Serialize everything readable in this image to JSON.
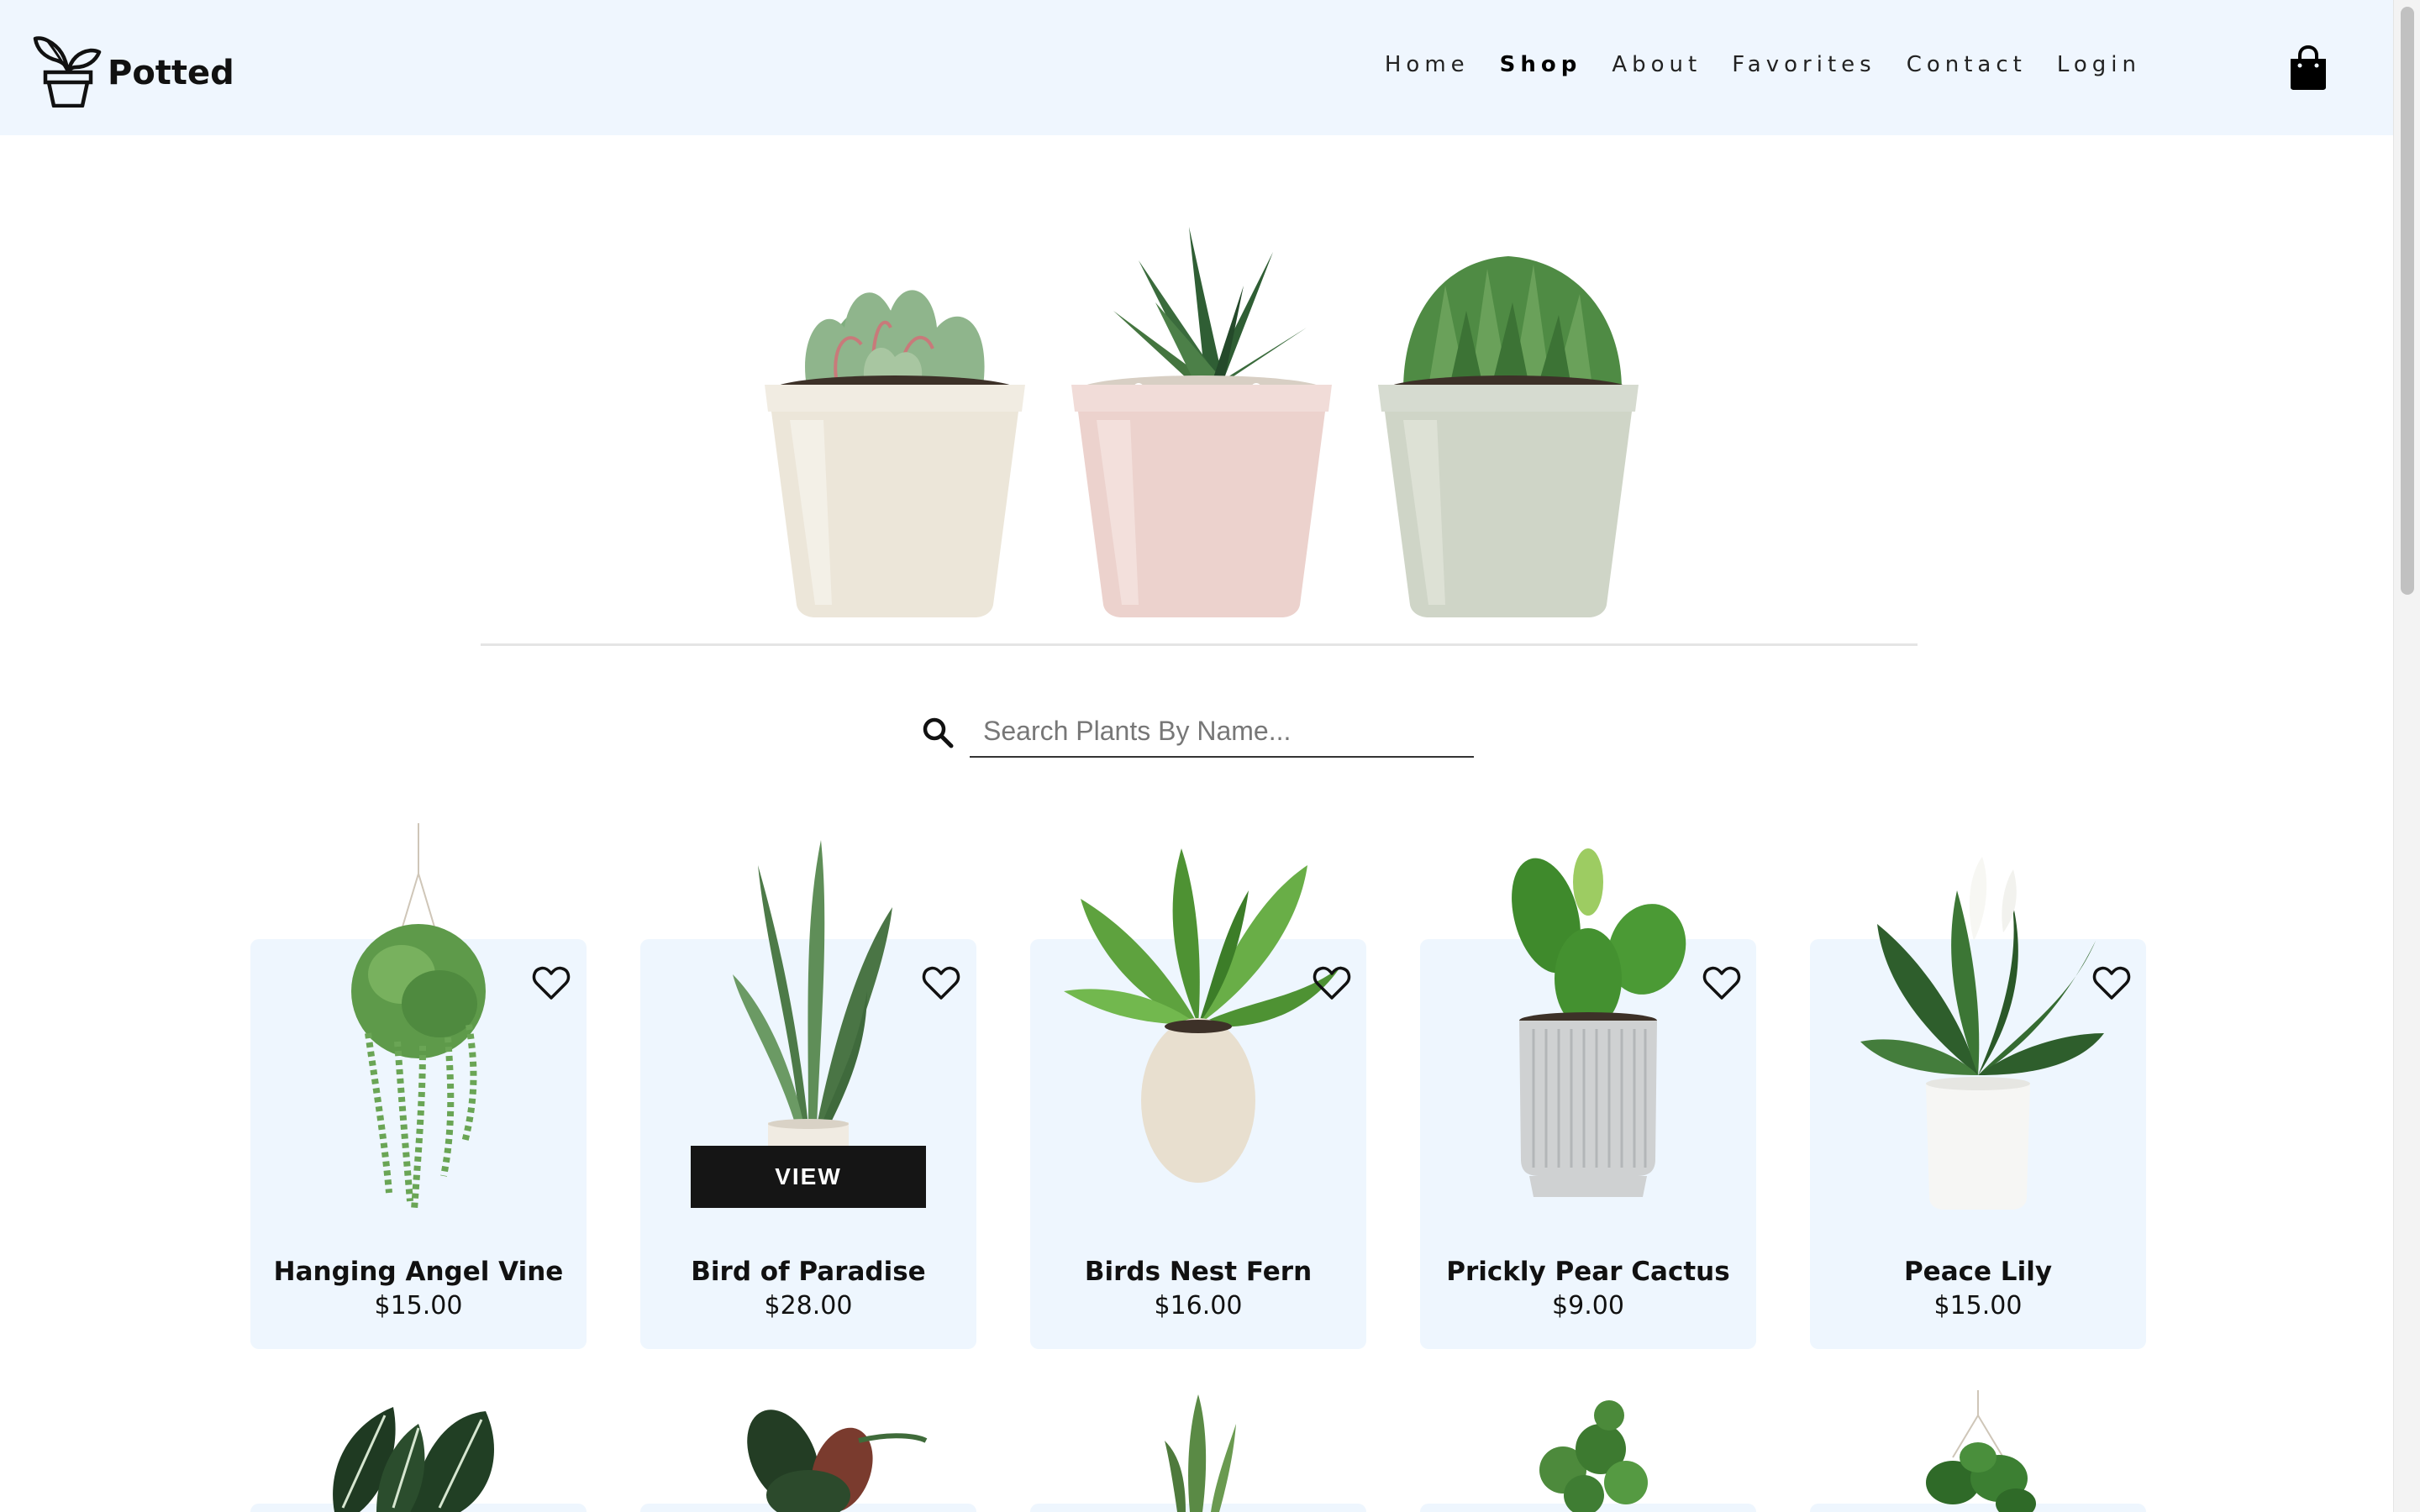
{
  "header": {
    "brand": "Potted",
    "nav": [
      "Home",
      "Shop",
      "About",
      "Favorites",
      "Contact",
      "Login"
    ],
    "active_nav": "Shop",
    "cart_icon": "shopping-bag-icon"
  },
  "hero": {
    "pots": [
      {
        "name": "succulent-echeveria",
        "pot_color": "#f1ece2"
      },
      {
        "name": "succulent-haworthia",
        "pot_color": "#f1dcd8"
      },
      {
        "name": "succulent-aloe",
        "pot_color": "#d6dbd0"
      }
    ]
  },
  "search": {
    "placeholder": "Search Plants By Name...",
    "value": "",
    "icon": "search-icon"
  },
  "products": [
    {
      "name": "Hanging Angel Vine",
      "price": "$15.00"
    },
    {
      "name": "Bird of Paradise",
      "price": "$28.00"
    },
    {
      "name": "Birds Nest Fern",
      "price": "$16.00"
    },
    {
      "name": "Prickly Pear Cactus",
      "price": "$9.00"
    },
    {
      "name": "Peace Lily",
      "price": "$15.00"
    }
  ],
  "view_label": "VIEW",
  "colors": {
    "header_bg": "#eff6fe",
    "card_bg": "#eef6fe",
    "leaf_green": "#3e8f3a",
    "view_button": "#151515"
  }
}
